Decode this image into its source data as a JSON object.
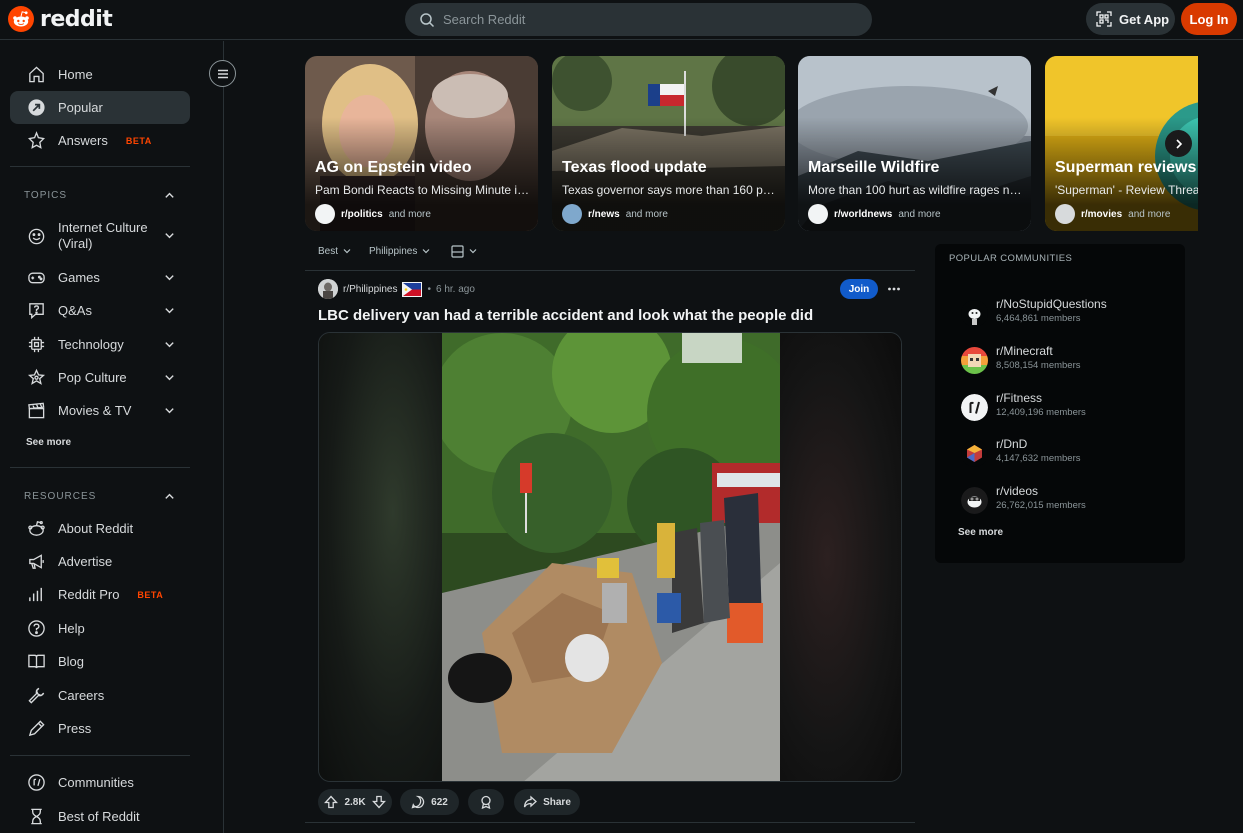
{
  "header": {
    "logo_text": "reddit",
    "search_placeholder": "Search Reddit",
    "get_app_label": "Get App",
    "login_label": "Log In",
    "accent_color": "#d93a00"
  },
  "sidebar": {
    "main_items": [
      {
        "label": "Home",
        "icon": "home-icon"
      },
      {
        "label": "Popular",
        "icon": "popular-icon",
        "active": true
      },
      {
        "label": "Answers",
        "icon": "answers-icon",
        "badge": "BETA"
      }
    ],
    "topics_heading": "TOPICS",
    "topics": [
      {
        "label": "Internet Culture (Viral)",
        "icon": "smile-icon"
      },
      {
        "label": "Games",
        "icon": "gamepad-icon"
      },
      {
        "label": "Q&As",
        "icon": "question-bubble-icon"
      },
      {
        "label": "Technology",
        "icon": "chip-icon"
      },
      {
        "label": "Pop Culture",
        "icon": "star-icon"
      },
      {
        "label": "Movies & TV",
        "icon": "clapperboard-icon"
      }
    ],
    "topics_see_more": "See more",
    "resources_heading": "RESOURCES",
    "resources": [
      {
        "label": "About Reddit",
        "icon": "reddit-alien-icon"
      },
      {
        "label": "Advertise",
        "icon": "megaphone-icon"
      },
      {
        "label": "Reddit Pro",
        "icon": "bar-chart-icon",
        "badge": "BETA"
      },
      {
        "label": "Help",
        "icon": "help-icon"
      },
      {
        "label": "Blog",
        "icon": "book-icon"
      },
      {
        "label": "Careers",
        "icon": "wrench-icon"
      },
      {
        "label": "Press",
        "icon": "pen-icon"
      }
    ],
    "footer_items": [
      {
        "label": "Communities",
        "icon": "communities-icon"
      },
      {
        "label": "Best of Reddit",
        "icon": "hourglass-icon"
      }
    ]
  },
  "carousel": [
    {
      "title": "AG on Epstein video",
      "description": "Pam Bondi Reacts to Missing Minute in ...",
      "subreddit": "r/politics",
      "more": "and more"
    },
    {
      "title": "Texas flood update",
      "description": "Texas governor says more than 160 peo...",
      "subreddit": "r/news",
      "more": "and more"
    },
    {
      "title": "Marseille Wildfire",
      "description": "More than 100 hurt as wildfire rages ne...",
      "subreddit": "r/worldnews",
      "more": "and more"
    },
    {
      "title": "Superman reviews",
      "description": "'Superman' - Review Thread",
      "subreddit": "r/movies",
      "more": "and more"
    }
  ],
  "feed": {
    "sort": {
      "order": "Best",
      "location": "Philippines"
    },
    "post": {
      "subreddit": "r/Philippines",
      "separator": "•",
      "time": "6 hr. ago",
      "join_label": "Join",
      "title": "LBC delivery van had a terrible accident and look what the people did",
      "upvotes": "2.8K",
      "comments": "622",
      "share_label": "Share"
    }
  },
  "communities": {
    "heading": "POPULAR COMMUNITIES",
    "items": [
      {
        "name": "r/NoStupidQuestions",
        "members": "6,464,861 members"
      },
      {
        "name": "r/Minecraft",
        "members": "8,508,154 members"
      },
      {
        "name": "r/Fitness",
        "members": "12,409,196 members"
      },
      {
        "name": "r/DnD",
        "members": "4,147,632 members"
      },
      {
        "name": "r/videos",
        "members": "26,762,015 members"
      }
    ],
    "see_more": "See more"
  }
}
